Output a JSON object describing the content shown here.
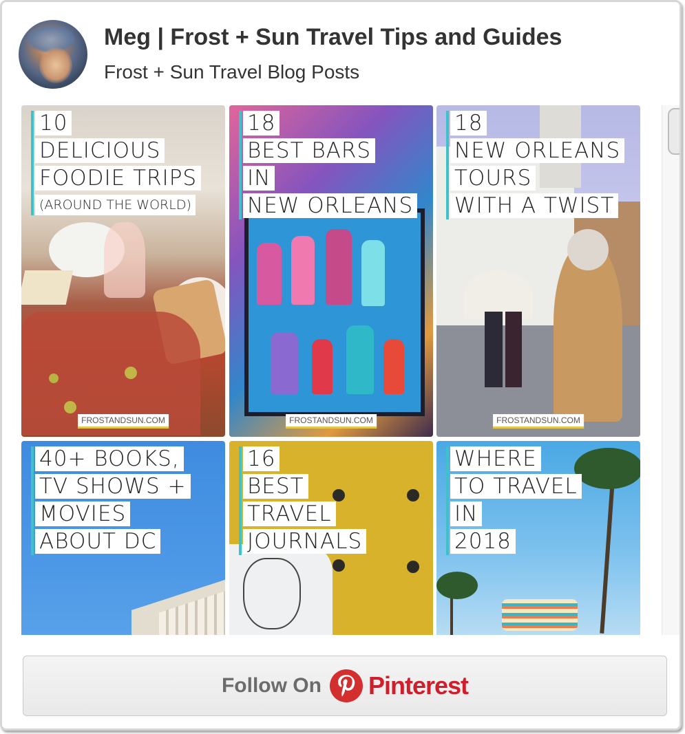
{
  "header": {
    "title": "Meg | Frost + Sun Travel Tips and Guides",
    "subtitle": "Frost + Sun Travel Blog Posts"
  },
  "pins": [
    {
      "lines": [
        "10",
        "DELICIOUS",
        "FOODIE TRIPS",
        "(AROUND THE WORLD)"
      ],
      "watermark": "FROSTANDSUN.COM"
    },
    {
      "lines": [
        "18",
        "BEST BARS",
        "IN",
        "NEW ORLEANS"
      ],
      "watermark": "FROSTANDSUN.COM"
    },
    {
      "lines": [
        "18",
        "NEW ORLEANS",
        "TOURS",
        "WITH A TWIST"
      ],
      "watermark": "FROSTANDSUN.COM"
    },
    {
      "lines": [
        "40+ BOOKS,",
        "TV SHOWS +",
        "MOVIES",
        "ABOUT DC"
      ]
    },
    {
      "lines": [
        "16",
        "BEST",
        "TRAVEL",
        "JOURNALS"
      ]
    },
    {
      "lines": [
        "WHERE",
        "TO TRAVEL",
        "IN",
        "2018"
      ]
    }
  ],
  "follow": {
    "label": "Follow On",
    "brand": "Pinterest"
  },
  "colors": {
    "accent_bar": "#3ec1c9",
    "pinterest_red": "#cf1f2a"
  },
  "icons": {
    "logo": "pinterest-logo-icon"
  }
}
